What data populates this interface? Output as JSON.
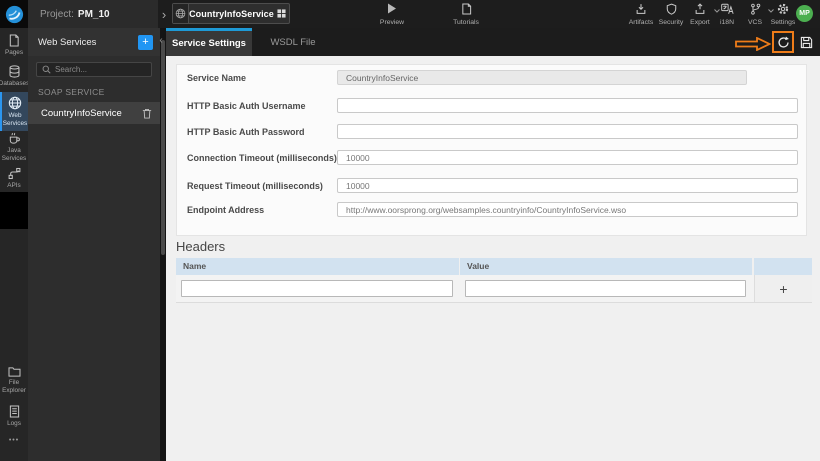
{
  "topbar": {
    "project_label": "Project:",
    "project_name": "PM_10",
    "entity_tab_label": "CountryInfoService",
    "preview_label": "Preview",
    "tutorials_label": "Tutorials",
    "artifacts_label": "Artifacts",
    "security_label": "Security",
    "export_label": "Export",
    "i18n_label": "i18N",
    "vcs_label": "VCS",
    "settings_label": "Settings",
    "avatar_initials": "MP"
  },
  "sidebar": {
    "items": [
      {
        "label": "Pages"
      },
      {
        "label": "Databases"
      },
      {
        "label": "Web Services"
      },
      {
        "label": "Java Services"
      },
      {
        "label": "APIs"
      },
      {
        "label": "File Explorer"
      },
      {
        "label": "Logs"
      }
    ],
    "active_item": "Web Services"
  },
  "services_panel": {
    "title": "Web Services",
    "add_button_label": "+",
    "search_placeholder": "Search...",
    "section_label": "SOAP SERVICE",
    "items": [
      {
        "name": "CountryInfoService"
      }
    ]
  },
  "tabs": [
    {
      "label": "Service Settings",
      "active": true
    },
    {
      "label": "WSDL File",
      "active": false
    }
  ],
  "form": {
    "fields": [
      {
        "label": "Service Name",
        "value": "CountryInfoService",
        "disabled": true
      },
      {
        "label": "HTTP Basic Auth Username",
        "value": ""
      },
      {
        "label": "HTTP Basic Auth Password",
        "value": ""
      },
      {
        "label": "Connection Timeout (milliseconds)",
        "value": "10000"
      },
      {
        "label": "Request Timeout (milliseconds)",
        "value": "10000"
      },
      {
        "label": "Endpoint Address",
        "value": "http://www.oorsprong.org/websamples.countryinfo/CountryInfoService.wso"
      }
    ]
  },
  "headers_section": {
    "title": "Headers",
    "columns": [
      "Name",
      "Value"
    ],
    "add_button_label": "+"
  },
  "icons": {
    "breadcrumb_chevron": "›",
    "collapse_chevron": "‹",
    "more_dots": "•••"
  },
  "colors": {
    "accent_blue": "#2196f3",
    "tab_underline_blue": "#1e9ad6",
    "annotation_orange": "#ee7c19",
    "avatar_green": "#4caf50",
    "table_header_blue": "#d2e2f0",
    "sidebar_active_bg": "#33475c"
  }
}
